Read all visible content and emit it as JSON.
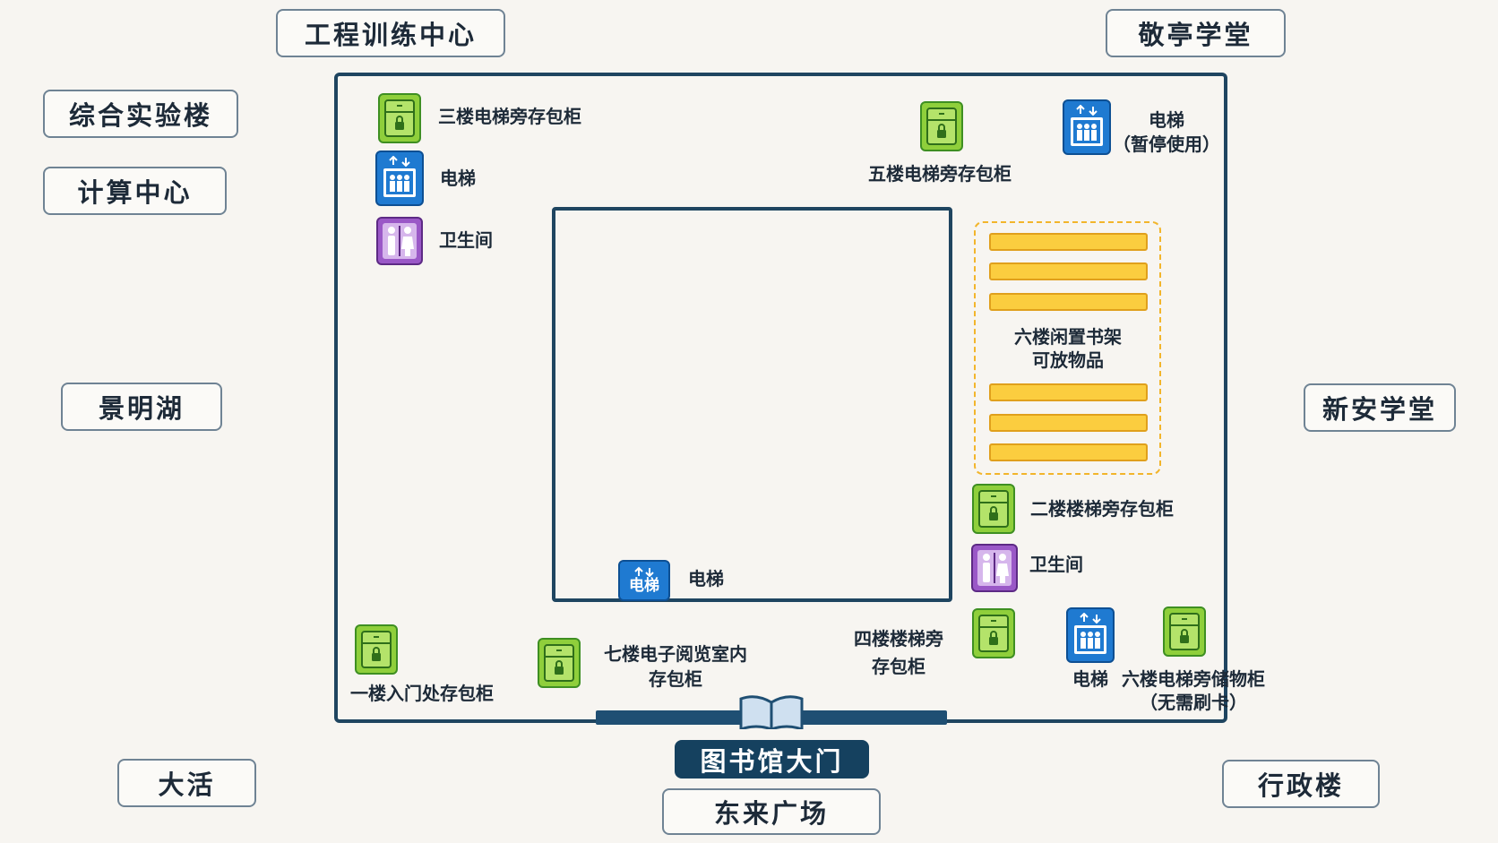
{
  "surroundings": {
    "engineering_center": "工程训练中心",
    "jingting_hall": "敬亭学堂",
    "comprehensive_lab": "综合实验楼",
    "computing_center": "计算中心",
    "jingming_lake": "景明湖",
    "xinan_hall": "新安学堂",
    "dahuo": "大活",
    "admin_building": "行政楼",
    "library_gate": "图书馆大门",
    "donglai_square": "东来广场"
  },
  "facilities": {
    "locker_3f_elevator": "三楼电梯旁存包柜",
    "elevator_left": "电梯",
    "restroom_left": "卫生间",
    "locker_5f_elevator": "五楼电梯旁存包柜",
    "elevator_top_right": "电梯",
    "elevator_top_right_note": "（暂停使用）",
    "shelf_6f_line1": "六楼闲置书架",
    "shelf_6f_line2": "可放物品",
    "locker_2f_stairs": "二楼楼梯旁存包柜",
    "restroom_right": "卫生间",
    "elevator_inner": "电梯",
    "elevator_inner_icon_text": "电梯",
    "locker_1f_entrance": "一楼入门处存包柜",
    "locker_7f_line1": "七楼电子阅览室内",
    "locker_7f_line2": "存包柜",
    "locker_4f_line1": "四楼楼梯旁",
    "locker_4f_line2": "存包柜",
    "elevator_bottom_right": "电梯",
    "locker_6f_line1": "六楼电梯旁储物柜",
    "locker_6f_line2": "（无需刷卡）"
  },
  "colors": {
    "locker": "#8fcf3b",
    "elevator": "#1f7ad1",
    "restroom": "#9a58c7",
    "shelf": "#fbcd3f",
    "wall": "#1f4560",
    "gate": "#15415f"
  },
  "icons": [
    "locker-icon",
    "elevator-icon",
    "restroom-icon",
    "open-book-icon"
  ]
}
